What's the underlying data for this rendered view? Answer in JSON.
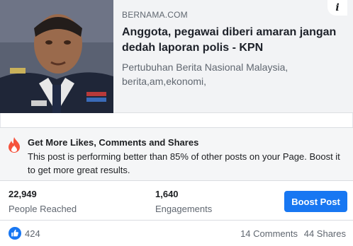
{
  "link_card": {
    "source": "BERNAMA.COM",
    "headline": "Anggota, pegawai diberi amaran jangan dedah laporan polis - KPN",
    "description_line1": "Pertubuhan Berita Nasional Malaysia,",
    "description_line2": "berita,am,ekonomi,",
    "info_label": "i"
  },
  "promo": {
    "icon": "fire-icon",
    "title": "Get More Likes, Comments and Shares",
    "body": "This post is performing better than 85% of other posts on your Page. Boost it to get more great results."
  },
  "stats": {
    "people_reached": {
      "value": "22,949",
      "label": "People Reached"
    },
    "engagements": {
      "value": "1,640",
      "label": "Engagements"
    },
    "boost_label": "Boost Post"
  },
  "footer": {
    "like_icon": "like-icon",
    "likes": "424",
    "comments": "14 Comments",
    "shares": "44 Shares"
  },
  "colors": {
    "accent": "#1877f2",
    "fire": "#f5533d",
    "secondary_text": "#606770"
  }
}
